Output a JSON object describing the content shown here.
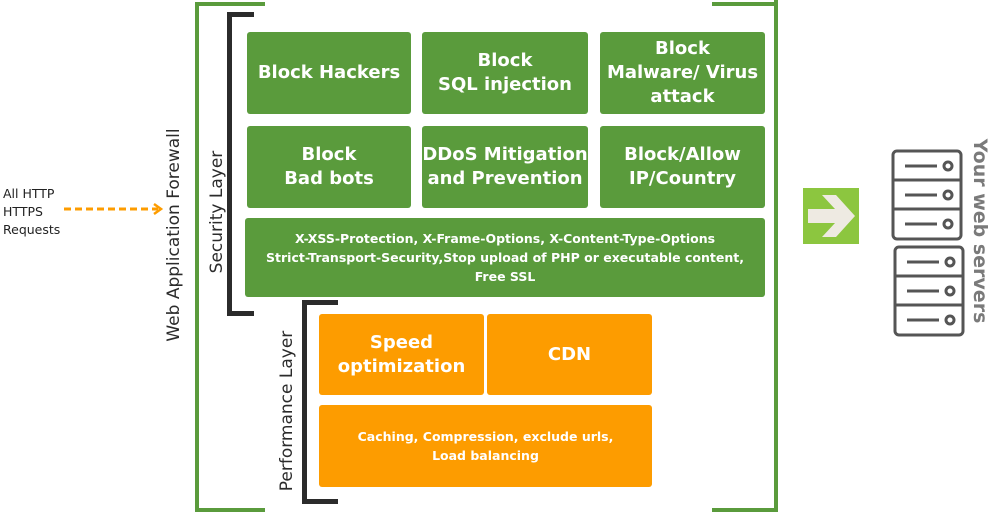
{
  "input": {
    "label": "All HTTP\nHTTPS\nRequests",
    "arrow_color": "#fd9c00"
  },
  "firewall": {
    "label": "Web Application Forewall",
    "color": "#5a9b3c"
  },
  "security_layer": {
    "label": "Security Layer",
    "boxes": [
      "Block Hackers",
      "Block\nSQL injection",
      "Block\nMalware/ Virus\nattack",
      "Block\nBad bots",
      "DDoS Mitigation\nand Prevention",
      "Block/Allow\nIP/Country"
    ],
    "headers_box": "X-XSS-Protection, X-Frame-Options, X-Content-Type-Options\nStrict-Transport-Security,Stop upload of PHP or executable content,\nFree SSL",
    "color": "#5a9b3c"
  },
  "performance_layer": {
    "label": "Performance Layer",
    "boxes": [
      "Speed\noptimization",
      "CDN"
    ],
    "wide_box": "Caching, Compression, exclude urls,\nLoad balancing",
    "color": "#fd9c00"
  },
  "servers": {
    "label": "Your web servers",
    "icon": "server-rack-icon",
    "forward_icon": "green-arrow-right-icon"
  }
}
